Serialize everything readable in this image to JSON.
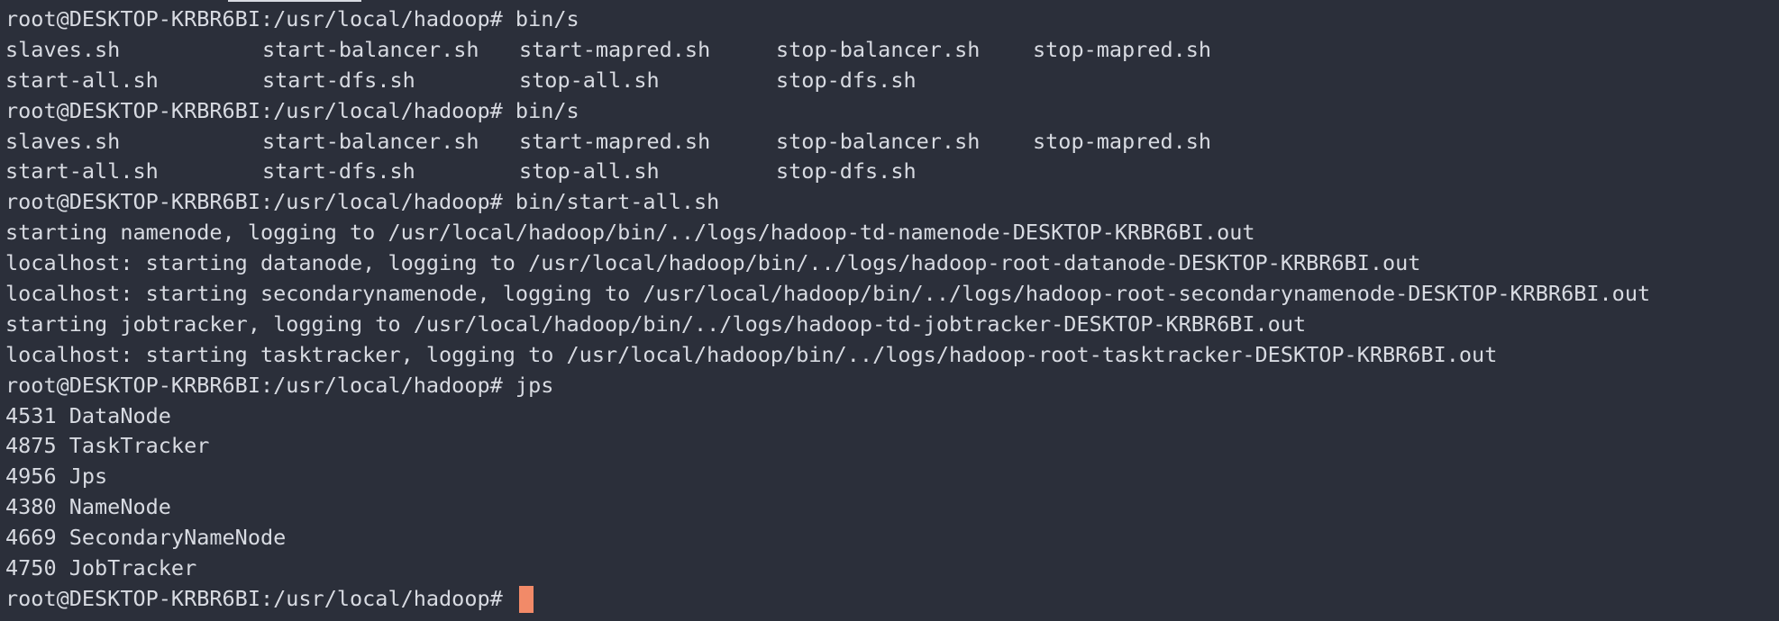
{
  "terminal": {
    "lines": [
      {
        "type": "prompt",
        "text": "root@DESKTOP-KRBR6BI:/usr/local/hadoop# bin/s"
      },
      {
        "type": "cols",
        "items": [
          "slaves.sh",
          "start-balancer.sh",
          "start-mapred.sh",
          "stop-balancer.sh",
          "stop-mapred.sh"
        ]
      },
      {
        "type": "cols",
        "items": [
          "start-all.sh",
          "start-dfs.sh",
          "stop-all.sh",
          "stop-dfs.sh"
        ]
      },
      {
        "type": "prompt",
        "text": "root@DESKTOP-KRBR6BI:/usr/local/hadoop# bin/s"
      },
      {
        "type": "cols",
        "items": [
          "slaves.sh",
          "start-balancer.sh",
          "start-mapred.sh",
          "stop-balancer.sh",
          "stop-mapred.sh"
        ]
      },
      {
        "type": "cols",
        "items": [
          "start-all.sh",
          "start-dfs.sh",
          "stop-all.sh",
          "stop-dfs.sh"
        ]
      },
      {
        "type": "prompt",
        "text": "root@DESKTOP-KRBR6BI:/usr/local/hadoop# bin/start-all.sh"
      },
      {
        "type": "output",
        "text": "starting namenode, logging to /usr/local/hadoop/bin/../logs/hadoop-td-namenode-DESKTOP-KRBR6BI.out"
      },
      {
        "type": "output",
        "text": "localhost: starting datanode, logging to /usr/local/hadoop/bin/../logs/hadoop-root-datanode-DESKTOP-KRBR6BI.out"
      },
      {
        "type": "output",
        "text": "localhost: starting secondarynamenode, logging to /usr/local/hadoop/bin/../logs/hadoop-root-secondarynamenode-DESKTOP-KRBR6BI.out"
      },
      {
        "type": "output",
        "text": "starting jobtracker, logging to /usr/local/hadoop/bin/../logs/hadoop-td-jobtracker-DESKTOP-KRBR6BI.out"
      },
      {
        "type": "output",
        "text": "localhost: starting tasktracker, logging to /usr/local/hadoop/bin/../logs/hadoop-root-tasktracker-DESKTOP-KRBR6BI.out"
      },
      {
        "type": "prompt",
        "text": "root@DESKTOP-KRBR6BI:/usr/local/hadoop# jps"
      },
      {
        "type": "output",
        "text": "4531 DataNode"
      },
      {
        "type": "output",
        "text": "4875 TaskTracker"
      },
      {
        "type": "output",
        "text": "4956 Jps"
      },
      {
        "type": "output",
        "text": "4380 NameNode"
      },
      {
        "type": "output",
        "text": "4669 SecondaryNameNode"
      },
      {
        "type": "output",
        "text": "4750 JobTracker"
      }
    ],
    "current_prompt": "root@DESKTOP-KRBR6BI:/usr/local/hadoop# ",
    "colors": {
      "background": "#2b2f3a",
      "foreground": "#d8dbe2",
      "cursor": "#f28a68"
    }
  }
}
